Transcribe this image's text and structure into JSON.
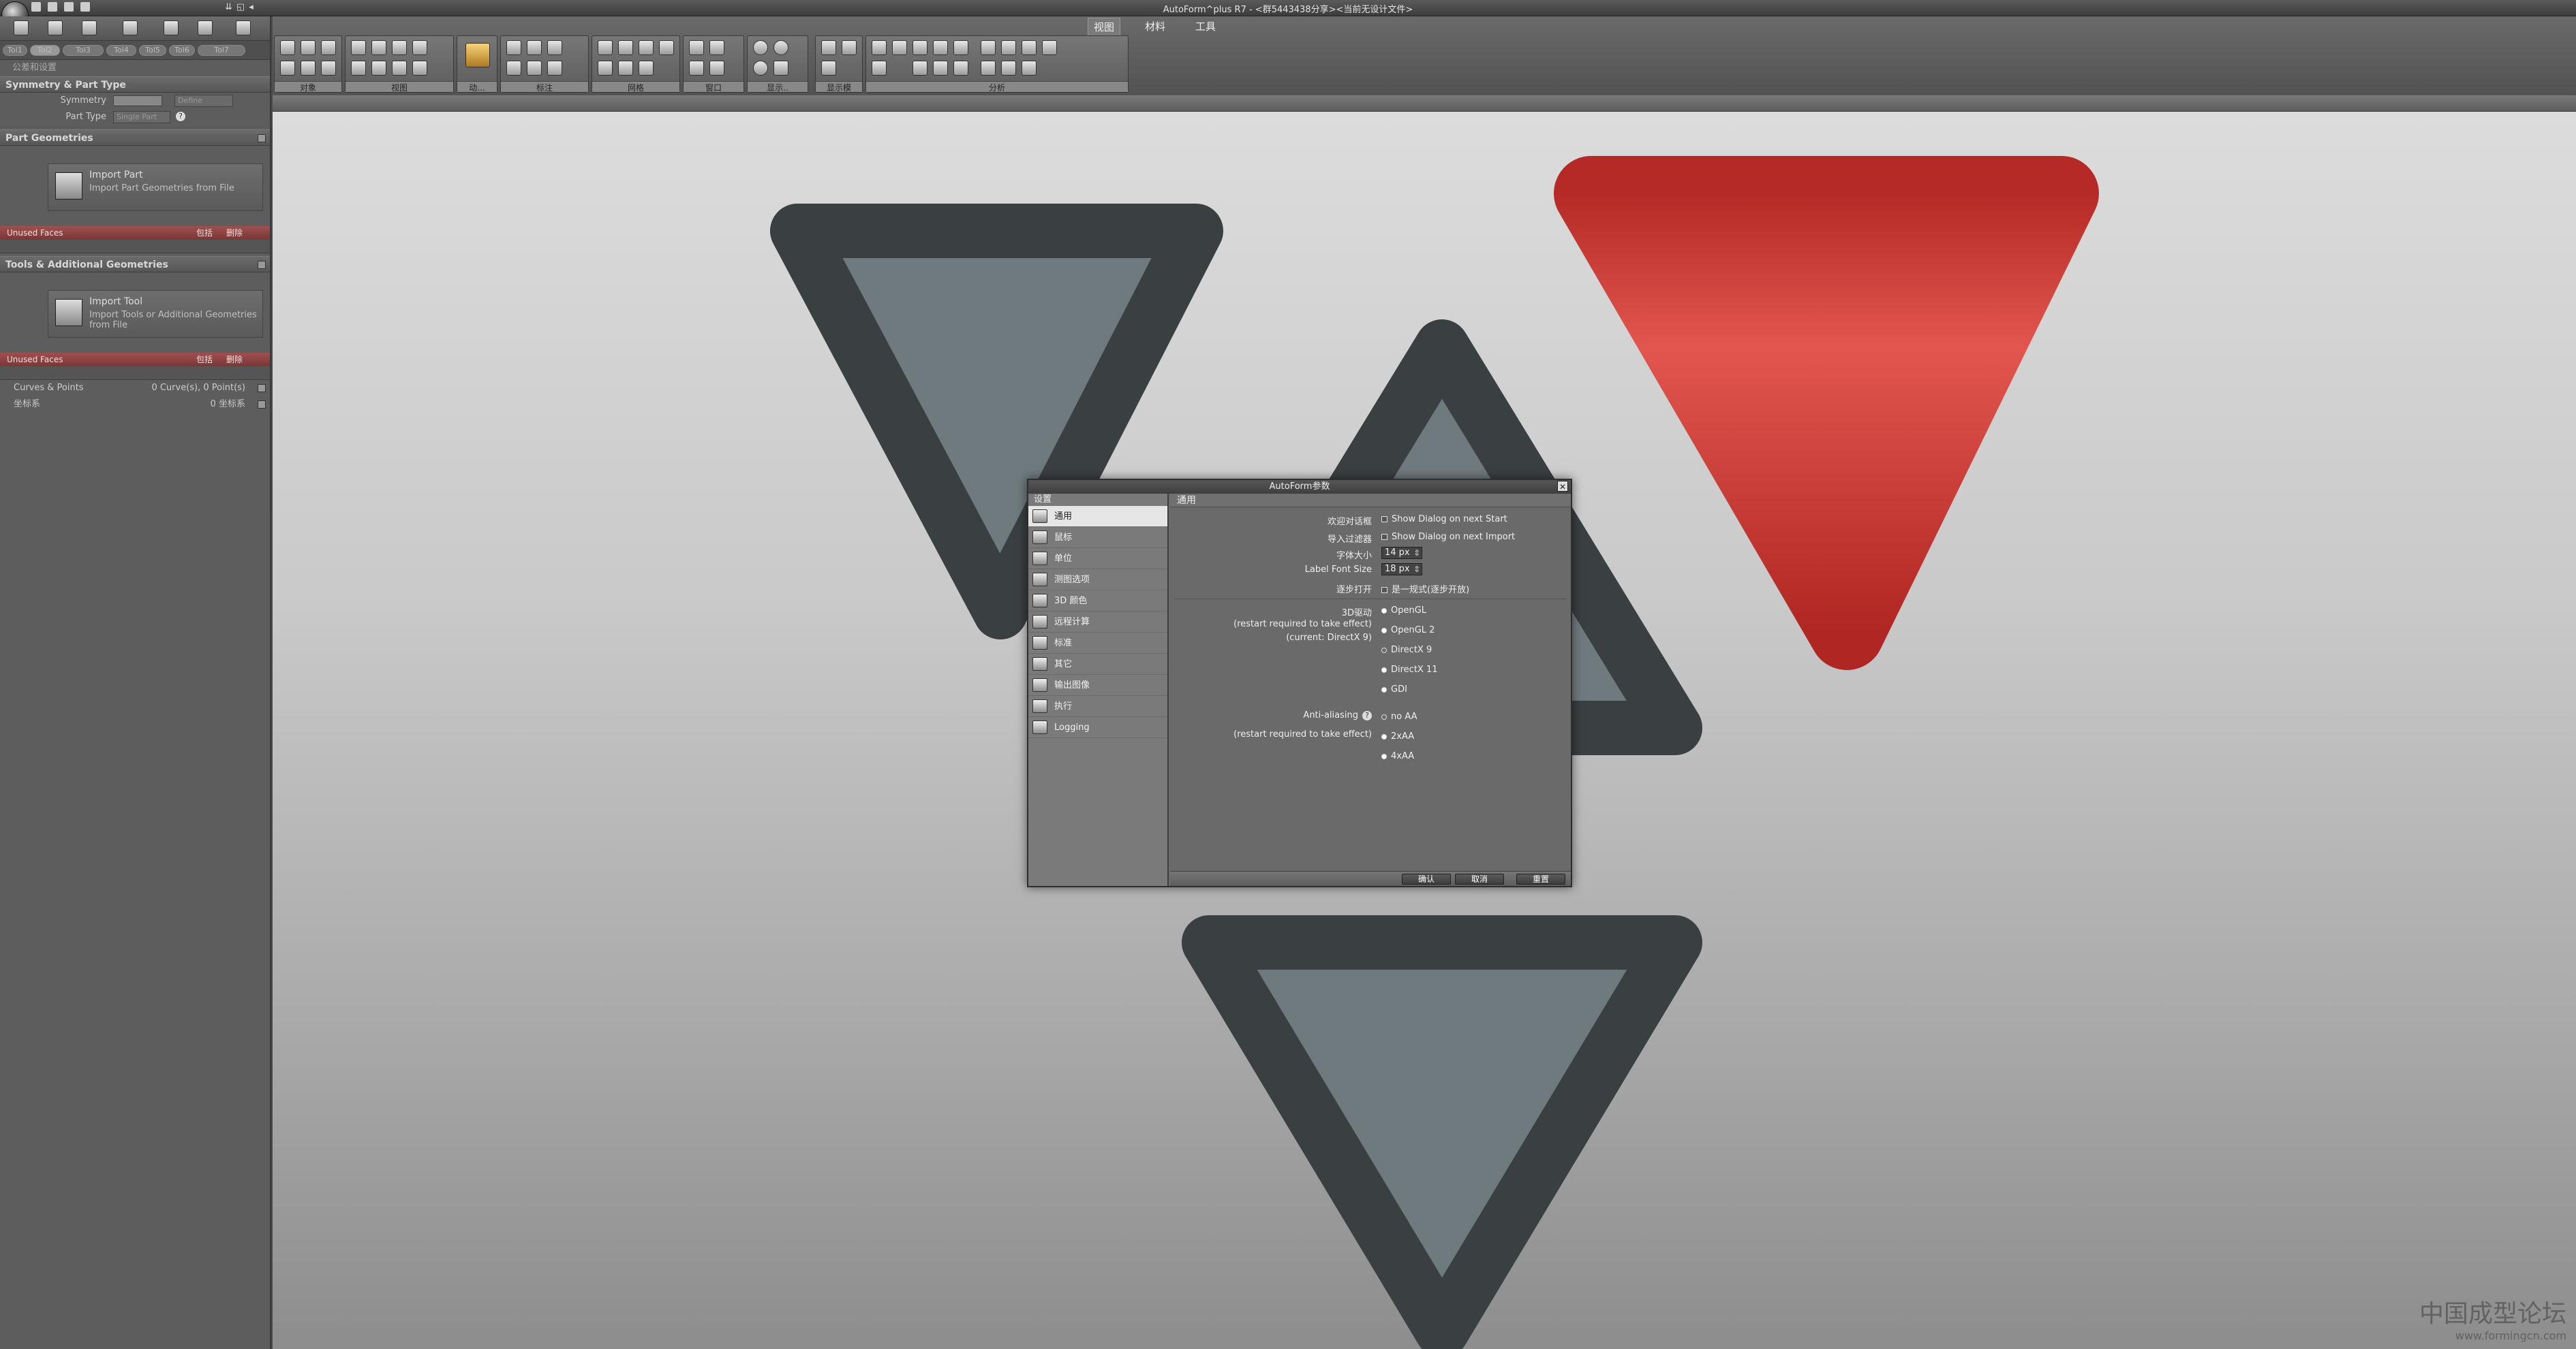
{
  "window": {
    "title": "AutoForm^plus R7 - <群5443438分享><当前无设计文件>",
    "controls": [
      "⇊",
      "◱",
      "◂"
    ]
  },
  "ribbon": {
    "tabs": [
      "视图",
      "材料",
      "工具"
    ],
    "active_tab": "视图",
    "groups": [
      "对象",
      "视图",
      "动...",
      "标注",
      "网格",
      "窗口",
      "显示..",
      "显示模",
      "分析"
    ]
  },
  "left_panel": {
    "filter_chips": [
      "Tol1",
      "Tol2",
      "Tol3",
      "Tol4",
      "Tol5",
      "Tol6",
      "Tol7"
    ],
    "breadcrumb": "公差和设置",
    "symmetry_section": {
      "title": "Symmetry & Part Type",
      "symmetry_label": "Symmetry",
      "symmetry_value": "Define",
      "part_type_label": "Part Type",
      "part_type_value": "Single Part"
    },
    "part_geometries": {
      "title": "Part Geometries",
      "import_title": "Import Part",
      "import_sub": "Import Part Geometries from File",
      "unused_faces": "Unused Faces",
      "actions": [
        "包括",
        "删除"
      ]
    },
    "tools_section": {
      "title": "Tools & Additional Geometries",
      "import_title": "Import Tool",
      "import_sub": "Import Tools or Additional Geometries from File",
      "unused_faces": "Unused Faces",
      "actions": [
        "包括",
        "删除"
      ]
    },
    "curves": {
      "label": "Curves & Points",
      "value": "0 Curve(s), 0 Point(s)"
    },
    "coords": {
      "label": "坐标系",
      "value": "0 坐标系"
    }
  },
  "dialog": {
    "title": "AutoForm参数",
    "nav_header": "设置",
    "nav_items": [
      {
        "label": "通用",
        "icon": "general-icon"
      },
      {
        "label": "鼠标",
        "icon": "mouse-icon"
      },
      {
        "label": "单位",
        "icon": "units-icon"
      },
      {
        "label": "测图选项",
        "icon": "plot-icon"
      },
      {
        "label": "3D 颜色",
        "icon": "color-icon"
      },
      {
        "label": "远程计算",
        "icon": "remote-icon"
      },
      {
        "label": "标准",
        "icon": "standard-icon"
      },
      {
        "label": "其它",
        "icon": "other-icon"
      },
      {
        "label": "输出图像",
        "icon": "image-icon"
      },
      {
        "label": "执行",
        "icon": "run-icon"
      },
      {
        "label": "Logging",
        "icon": "log-icon"
      }
    ],
    "main_header": "通用",
    "fields": {
      "welcome_label": "欢迎对话框",
      "welcome_value": "Show Dialog on next Start",
      "import_filter_label": "导入过滤器",
      "import_filter_value": "Show Dialog on next Import",
      "font_size_label": "字体大小",
      "font_size_value": "14 px",
      "label_font_label": "Label Font Size",
      "label_font_value": "18 px",
      "quick_open_label": "逐步打开",
      "quick_open_value": "是一规式(逐步开放)",
      "driver_label": "3D驱动",
      "driver_note1": "(restart required to take effect)",
      "driver_note2": "(current: DirectX 9)",
      "drivers": [
        "OpenGL",
        "OpenGL 2",
        "DirectX 9",
        "DirectX 11",
        "GDI"
      ],
      "aa_label": "Anti-aliasing",
      "aa_note": "(restart required to take effect)",
      "aa_options": [
        "no AA",
        "2xAA",
        "4xAA"
      ]
    },
    "buttons": {
      "ok": "确认",
      "cancel": "取消",
      "reset": "重置"
    }
  },
  "viewport": {
    "logo_colors": {
      "dark": "#3a3f42",
      "fill": "#6f7a7e",
      "red": "#d9443f"
    }
  },
  "watermark": {
    "line1": "中国成型论坛",
    "line2": "www.formingcn.com"
  }
}
